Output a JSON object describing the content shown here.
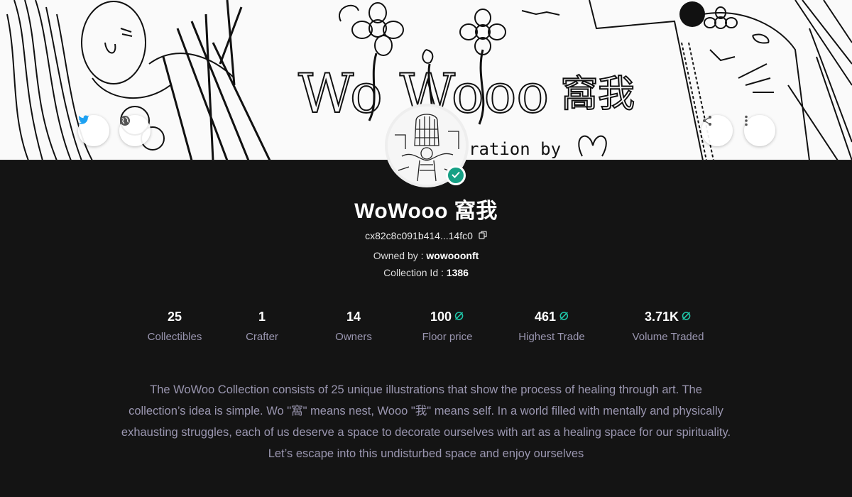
{
  "banner": {
    "art_text": "WoWooo 窩我",
    "credit_text": "ration by"
  },
  "social": {
    "twitter_icon": "twitter-bird-icon",
    "website_icon": "globe-icon",
    "share_icon": "share-icon",
    "more_icon": "more-vertical-icon",
    "twitter_color": "#1da1f2"
  },
  "collection": {
    "name": "WoWooo 窩我",
    "address": "cx82c8c091b414...14fc0",
    "owned_by_label": "Owned by :",
    "owner": "wowooonft",
    "collection_id_label": "Collection Id :",
    "collection_id": "1386",
    "verified": true,
    "verified_color": "#16a085"
  },
  "stats": [
    {
      "value": "25",
      "label": "Collectibles",
      "currency": false
    },
    {
      "value": "1",
      "label": "Crafter",
      "currency": false
    },
    {
      "value": "14",
      "label": "Owners",
      "currency": false
    },
    {
      "value": "100",
      "label": "Floor price",
      "currency": true
    },
    {
      "value": "461",
      "label": "Highest Trade",
      "currency": true
    },
    {
      "value": "3.71K",
      "label": "Volume Traded",
      "currency": true
    }
  ],
  "currency_icon": "icx-icon",
  "currency_color": "#1fc5a8",
  "description": "The WoWoo Collection consists of 25 unique illustrations that show the process of healing through art. The collection’s idea is simple. Wo \"窩\" means nest, Wooo \"我\" means self. In a world filled with mentally and physically exhausting struggles, each of us deserve a space to decorate ourselves with art as a healing space for our spirituality. Let’s escape into this undisturbed space and enjoy ourselves"
}
